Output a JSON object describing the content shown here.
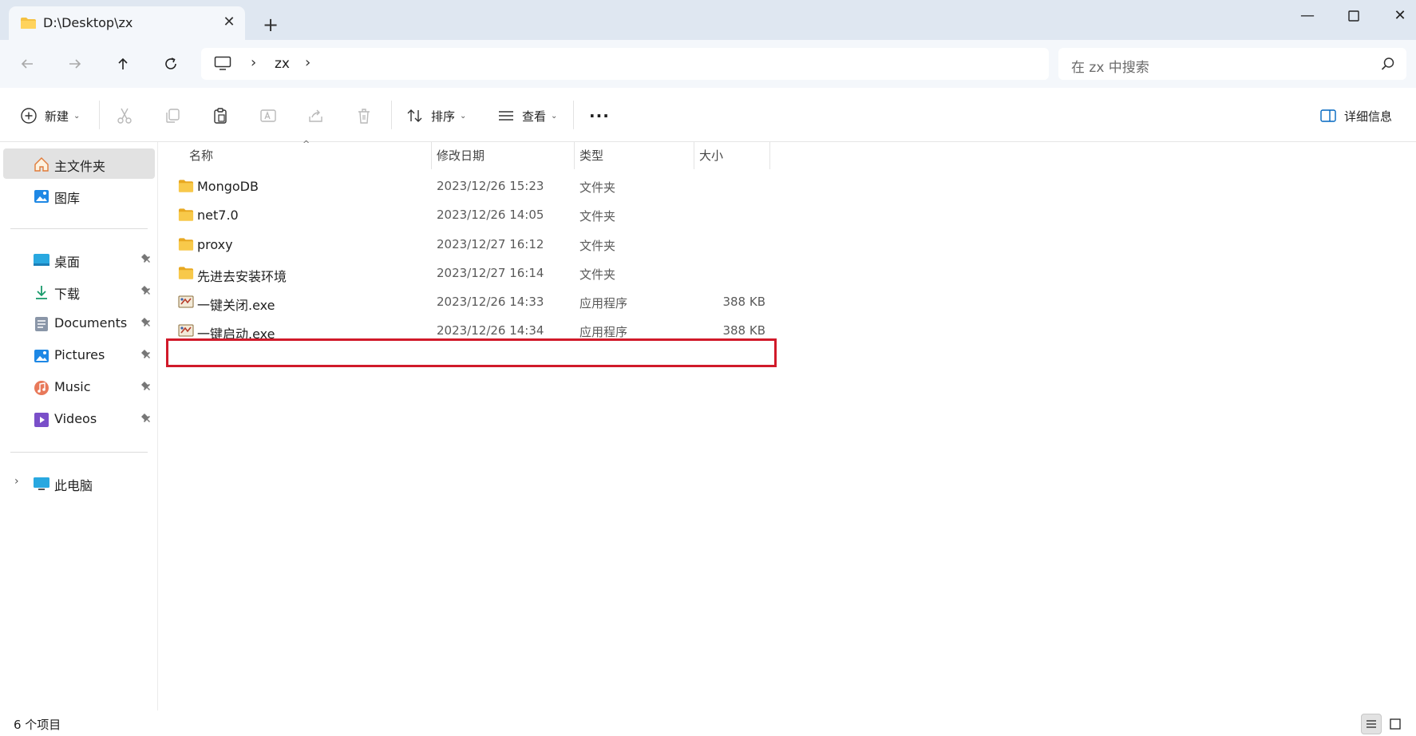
{
  "window": {
    "tab_title": "D:\\Desktop\\zx",
    "tab_close_glyph": "✕",
    "new_tab_glyph": "+",
    "minimize_glyph": "—",
    "close_glyph": "✕"
  },
  "address": {
    "breadcrumb": [
      "zx"
    ],
    "separator": "›",
    "search_placeholder": "在 zx 中搜索"
  },
  "toolbar": {
    "new_label": "新建",
    "sort_label": "排序",
    "view_label": "查看",
    "more_glyph": "···",
    "details_label": "详细信息",
    "chevron": "⌄"
  },
  "sidebar": {
    "home": "主文件夹",
    "gallery": "图库",
    "pinned": [
      {
        "label": "桌面",
        "icon": "desktop-icon"
      },
      {
        "label": "下载",
        "icon": "download-icon"
      },
      {
        "label": "Documents",
        "icon": "documents-icon"
      },
      {
        "label": "Pictures",
        "icon": "pictures-icon"
      },
      {
        "label": "Music",
        "icon": "music-icon"
      },
      {
        "label": "Videos",
        "icon": "videos-icon"
      }
    ],
    "this_pc": "此电脑",
    "expander": "›"
  },
  "columns": {
    "name": "名称",
    "modified": "修改日期",
    "type": "类型",
    "size": "大小",
    "sort_glyph": "^"
  },
  "files": [
    {
      "name": "MongoDB",
      "modified": "2023/12/26 15:23",
      "type": "文件夹",
      "size": "",
      "kind": "folder"
    },
    {
      "name": "net7.0",
      "modified": "2023/12/26 14:05",
      "type": "文件夹",
      "size": "",
      "kind": "folder"
    },
    {
      "name": "proxy",
      "modified": "2023/12/27 16:12",
      "type": "文件夹",
      "size": "",
      "kind": "folder"
    },
    {
      "name": "先进去安装环境",
      "modified": "2023/12/27 16:14",
      "type": "文件夹",
      "size": "",
      "kind": "folder"
    },
    {
      "name": "一键关闭.exe",
      "modified": "2023/12/26 14:33",
      "type": "应用程序",
      "size": "388 KB",
      "kind": "exe"
    },
    {
      "name": "一键启动.exe",
      "modified": "2023/12/26 14:34",
      "type": "应用程序",
      "size": "388 KB",
      "kind": "exe"
    }
  ],
  "status": {
    "item_count": "6 个项目"
  },
  "colors": {
    "accent": "#0067c0",
    "folder": "#f4c142",
    "highlight": "#d11a2a"
  }
}
